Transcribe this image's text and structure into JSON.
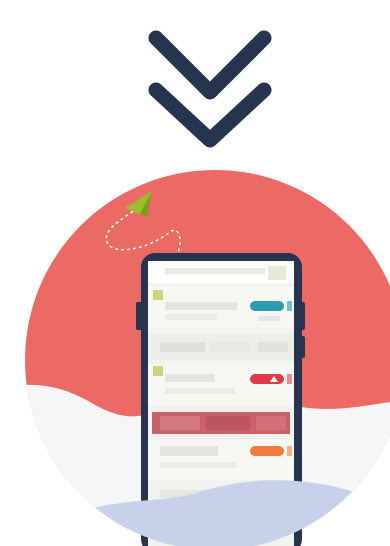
{
  "chevron": {
    "icon": "double-chevron-down-icon",
    "color": "#26344f"
  },
  "illustration": {
    "description_icon": "phone-app-illustration",
    "circle_color": "#ec6a66",
    "wave_color": "#f6f6f6",
    "bottom_wave_color": "#c7d1ea",
    "phone_frame_color": "#26344f",
    "paper_plane_icon": "paper-plane-icon",
    "paper_plane_color": "#9bbf2a",
    "list_rows": [
      {
        "badge_color": "#2b9bb0",
        "badge_icon": "none"
      },
      {
        "badge_color": "#e03a4a",
        "badge_icon": "warning-icon"
      },
      {
        "badge_color": "#f27a3a",
        "badge_icon": "none"
      }
    ],
    "highlight_row_color": "#c9606a"
  }
}
